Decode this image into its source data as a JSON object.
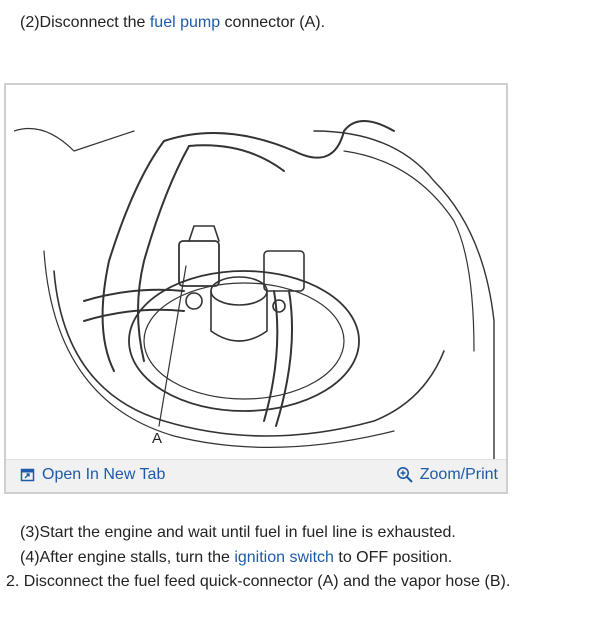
{
  "step2": {
    "pre": "(2)Disconnect the ",
    "link": "fuel pump",
    "post": " connector (A)."
  },
  "figure": {
    "callout_label": "A",
    "open_tab_label": "Open In New Tab",
    "zoom_label": "Zoom/Print",
    "open_tab_icon": "open-in-new-tab-icon",
    "zoom_icon": "magnifier-plus-icon"
  },
  "step3": {
    "text": "(3)Start the engine and wait until fuel in fuel line is exhausted."
  },
  "step4": {
    "pre": "(4)After engine stalls, turn the ",
    "link": "ignition switch",
    "post": " to OFF position."
  },
  "step5": {
    "text": "2. Disconnect the fuel feed quick-connector (A) and the vapor hose (B)."
  },
  "colors": {
    "link": "#1e5aa8",
    "border": "#cfcfcf",
    "toolbar": "#f1f1f1"
  }
}
